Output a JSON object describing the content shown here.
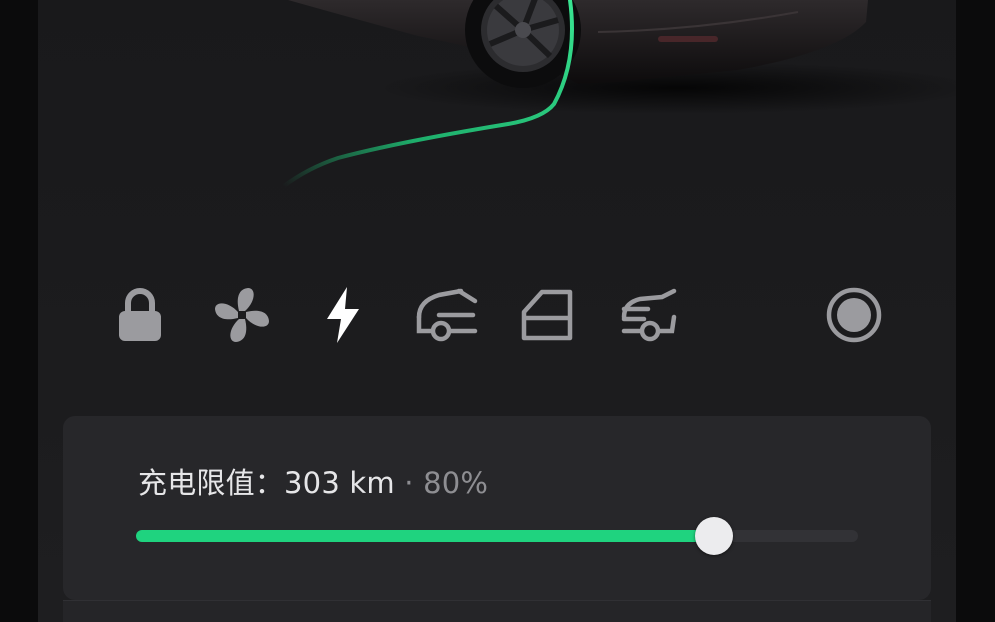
{
  "colors": {
    "accent_green": "#1fd37f",
    "icon_gray": "#9b9b9f",
    "icon_active": "#ffffff",
    "panel_bg": "#27272a"
  },
  "controls": [
    {
      "icon": "lock-icon",
      "active": false
    },
    {
      "icon": "fan-icon",
      "active": false
    },
    {
      "icon": "charge-bolt-icon",
      "active": true
    },
    {
      "icon": "frunk-icon",
      "active": false
    },
    {
      "icon": "window-icon",
      "active": false
    },
    {
      "icon": "trunk-icon",
      "active": false
    },
    {
      "icon": "record-icon",
      "active": false
    }
  ],
  "charge": {
    "label": "充电限值：",
    "range": "303 km",
    "separator": " · ",
    "percent": "80%",
    "limit_fraction": 0.8
  }
}
